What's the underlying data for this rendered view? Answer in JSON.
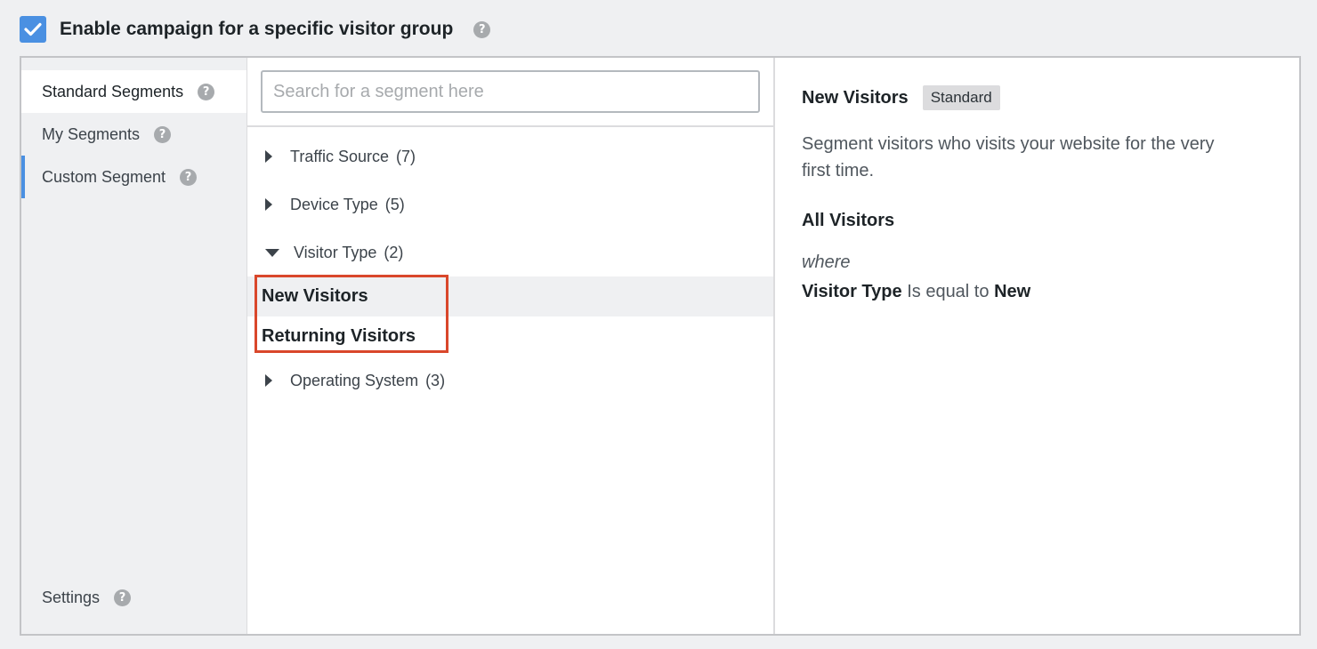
{
  "header": {
    "checkbox_checked": true,
    "label": "Enable campaign for a specific visitor group",
    "help": "?"
  },
  "sidebar": {
    "items": [
      {
        "label": "Standard Segments",
        "help": "?",
        "active": true
      },
      {
        "label": "My Segments",
        "help": "?"
      },
      {
        "label": "Custom Segment",
        "help": "?"
      }
    ],
    "settings": {
      "label": "Settings",
      "help": "?"
    }
  },
  "search": {
    "placeholder": "Search for a segment here",
    "value": ""
  },
  "groups": [
    {
      "label": "Traffic Source",
      "count": "(7)",
      "expanded": false
    },
    {
      "label": "Device Type",
      "count": "(5)",
      "expanded": false
    },
    {
      "label": "Visitor Type",
      "count": "(2)",
      "expanded": true,
      "children": [
        "New Visitors",
        "Returning Visitors"
      ]
    },
    {
      "label": "Operating System",
      "count": "(3)",
      "expanded": false
    }
  ],
  "detail": {
    "title": "New Visitors",
    "badge": "Standard",
    "description": "Segment visitors who visits your website for the very first time.",
    "scope": "All Visitors",
    "where": "where",
    "rule": {
      "field": "Visitor Type",
      "operator": "Is equal to",
      "value": "New"
    }
  },
  "colors": {
    "accent": "#4a90e2",
    "highlight": "#d9472b"
  }
}
